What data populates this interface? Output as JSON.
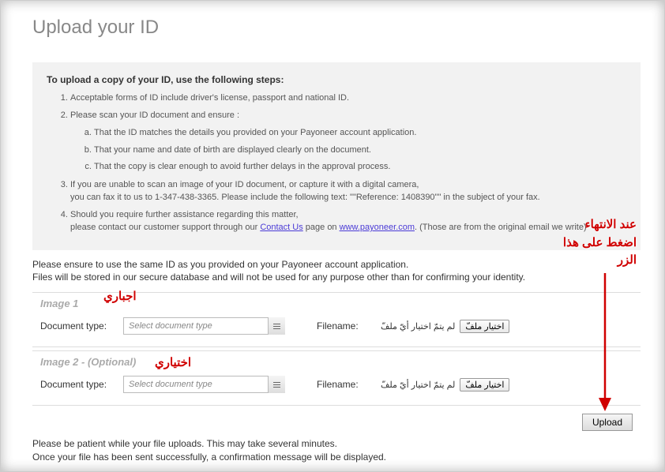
{
  "page_title": "Upload your ID",
  "instructions": {
    "heading": "To upload a copy of your ID, use the following steps:",
    "items": [
      "Acceptable forms of ID include driver's license, passport and national ID.",
      "Please scan your ID document and ensure :",
      "If you are unable to scan an image of your ID document, or capture it with a digital camera,",
      "Should you require further assistance regarding this matter,"
    ],
    "item3_line2_a": "you can fax it to us to 1-347-438-3365. Please include the following text: \"\"Reference: 1408390\"\" in the subject of your fax.",
    "item4_line2_a": "please contact our customer support through our ",
    "item4_link1": "Contact Us",
    "item4_line2_b": " page on ",
    "item4_link2": "www.payoneer.com",
    "item4_line2_c": ". (Those are from the original email we write)",
    "sublist": [
      "That the ID matches the details you provided on your Payoneer account application.",
      "That your name and date of birth are displayed clearly on the document.",
      "That the copy is clear enough to avoid further delays in the approval process."
    ]
  },
  "notice_line1": "Please ensure to use the same ID as you provided on your Payoneer account application.",
  "notice_line2": "Files will be stored in our secure database and will not be used for any purpose other than for confirming your identity.",
  "image1": {
    "title": "Image 1",
    "doc_type_label": "Document type:",
    "select_placeholder": "Select document type",
    "filename_label": "Filename:",
    "browse_btn": "اختيار ملفّ",
    "no_file": "لم يتمّ اختيار أيّ ملفّ"
  },
  "image2": {
    "title": "Image 2 - (Optional)",
    "doc_type_label": "Document type:",
    "select_placeholder": "Select document type",
    "filename_label": "Filename:",
    "browse_btn": "اختيار ملفّ",
    "no_file": "لم يتمّ اختيار أيّ ملفّ"
  },
  "upload_btn": "Upload",
  "footer_line1": "Please be patient while your file uploads. This may take several minutes.",
  "footer_line2": "Once your file has been sent successfully, a confirmation message will be displayed.",
  "annotations": {
    "mandatory": "اجباري",
    "optional": "اختياري",
    "finish_line1": "عند الانتهاء",
    "finish_line2": "اضغط على هذا",
    "finish_line3": "الزر"
  }
}
